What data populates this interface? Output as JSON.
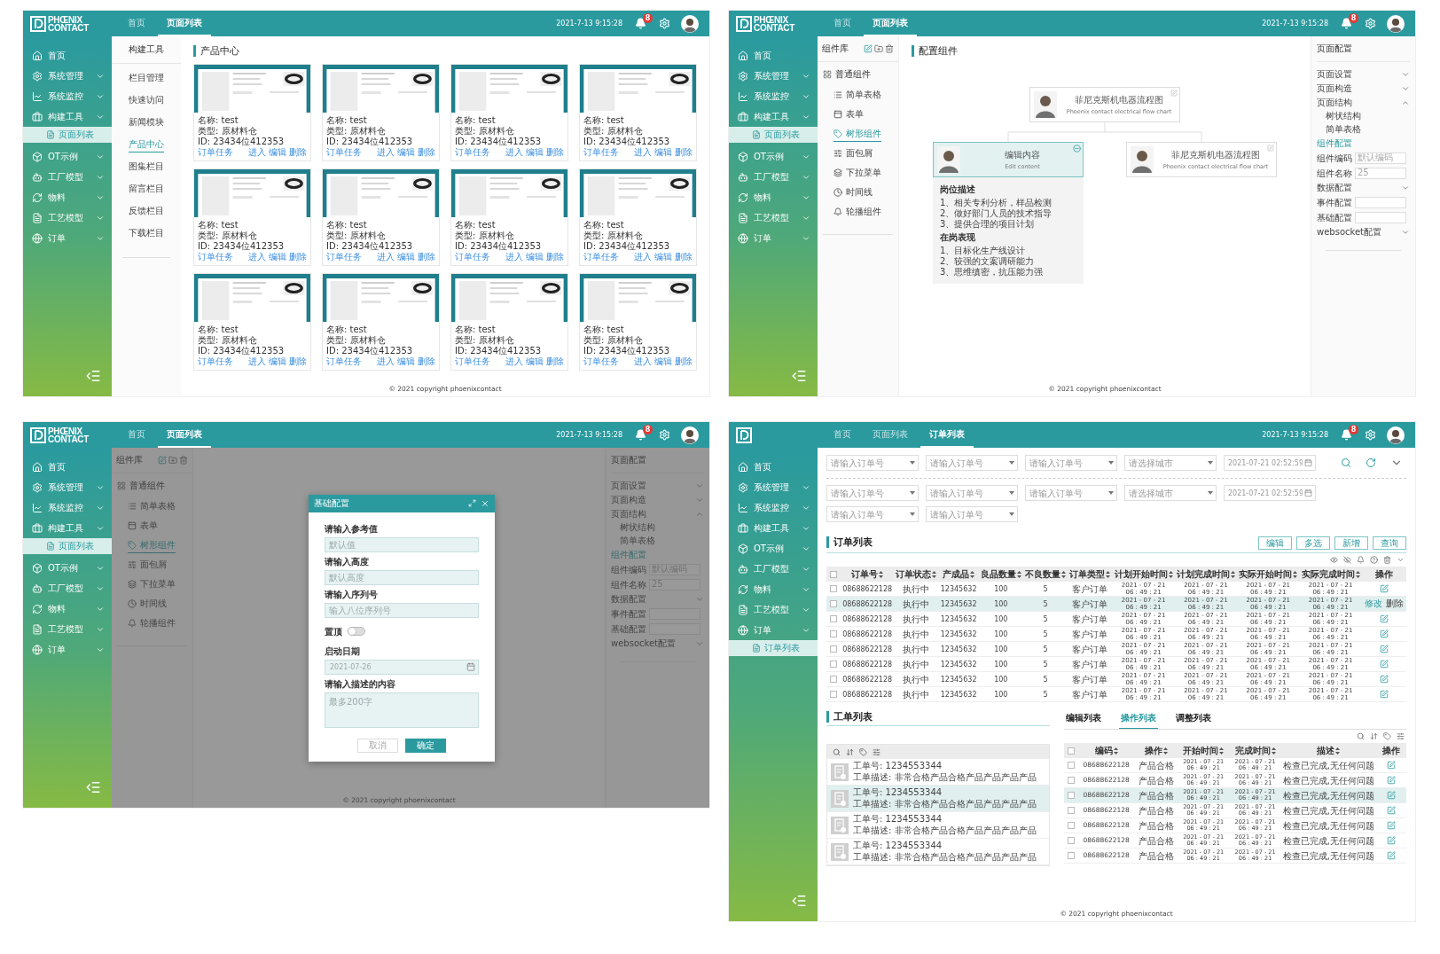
{
  "screens": [
    {
      "kind": "product_grid",
      "header": {
        "logo": {
          "line1": "PHŒNIX",
          "line2": "CONTACT"
        },
        "nav": [
          {
            "label": "首页",
            "selected": false
          },
          {
            "label": "页面列表",
            "selected": true
          }
        ],
        "datetime": "2021-7-13 9:15:28",
        "badge": "8"
      },
      "sidebar": {
        "items": [
          {
            "label": "首页",
            "submenu": false
          },
          {
            "label": "系统管理",
            "submenu": true
          },
          {
            "label": "系统监控",
            "submenu": true
          },
          {
            "label": "构建工具",
            "submenu": true,
            "children": [
              {
                "label": "页面列表",
                "selected": true
              }
            ]
          },
          {
            "label": "OT示例",
            "submenu": true
          },
          {
            "label": "工厂模型",
            "submenu": true
          },
          {
            "label": "物料",
            "submenu": true
          },
          {
            "label": "工艺模型",
            "submenu": true
          },
          {
            "label": "订单",
            "submenu": true
          }
        ]
      },
      "subnav": {
        "title": "构建工具",
        "items": [
          {
            "label": "栏目管理",
            "selected": false
          },
          {
            "label": "快速访问",
            "selected": false
          },
          {
            "label": "新闻模块",
            "selected": false
          },
          {
            "label": "产品中心",
            "selected": true
          },
          {
            "label": "图集栏目",
            "selected": false
          },
          {
            "label": "留言栏目",
            "selected": false
          },
          {
            "label": "反馈栏目",
            "selected": false
          },
          {
            "label": "下载栏目",
            "selected": false
          }
        ]
      },
      "main": {
        "title": "产品中心",
        "products": [
          {
            "name": "名称: test",
            "type": "类型: 原材料仓",
            "id": "ID: 23434位412353",
            "link": "订单任务",
            "actions": [
              "进入",
              "编辑",
              "删除"
            ]
          },
          {
            "name": "名称: test",
            "type": "类型: 原材料仓",
            "id": "ID: 23434位412353",
            "link": "订单任务",
            "actions": [
              "进入",
              "编辑",
              "删除"
            ]
          },
          {
            "name": "名称: test",
            "type": "类型: 原材料仓",
            "id": "ID: 23434位412353",
            "link": "订单任务",
            "actions": [
              "进入",
              "编辑",
              "删除"
            ]
          },
          {
            "name": "名称: test",
            "type": "类型: 原材料仓",
            "id": "ID: 23434位412353",
            "link": "订单任务",
            "actions": [
              "进入",
              "编辑",
              "删除"
            ]
          },
          {
            "name": "名称: test",
            "type": "类型: 原材料仓",
            "id": "ID: 23434位412353",
            "link": "订单任务",
            "actions": [
              "进入",
              "编辑",
              "删除"
            ]
          },
          {
            "name": "名称: test",
            "type": "类型: 原材料仓",
            "id": "ID: 23434位412353",
            "link": "订单任务",
            "actions": [
              "进入",
              "编辑",
              "删除"
            ]
          },
          {
            "name": "名称: test",
            "type": "类型: 原材料仓",
            "id": "ID: 23434位412353",
            "link": "订单任务",
            "actions": [
              "进入",
              "编辑",
              "删除"
            ]
          },
          {
            "name": "名称: test",
            "type": "类型: 原材料仓",
            "id": "ID: 23434位412353",
            "link": "订单任务",
            "actions": [
              "进入",
              "编辑",
              "删除"
            ]
          },
          {
            "name": "名称: test",
            "type": "类型: 原材料仓",
            "id": "ID: 23434位412353",
            "link": "订单任务",
            "actions": [
              "进入",
              "编辑",
              "删除"
            ]
          },
          {
            "name": "名称: test",
            "type": "类型: 原材料仓",
            "id": "ID: 23434位412353",
            "link": "订单任务",
            "actions": [
              "进入",
              "编辑",
              "删除"
            ]
          },
          {
            "name": "名称: test",
            "type": "类型: 原材料仓",
            "id": "ID: 23434位412353",
            "link": "订单任务",
            "actions": [
              "进入",
              "编辑",
              "删除"
            ]
          },
          {
            "name": "名称: test",
            "type": "类型: 原材料仓",
            "id": "ID: 23434位412353",
            "link": "订单任务",
            "actions": [
              "进入",
              "编辑",
              "删除"
            ]
          }
        ]
      },
      "footer": "© 2021 copyright phoenixcontact"
    },
    {
      "kind": "component_config",
      "header": {
        "logo": {
          "line1": "PHŒNIX",
          "line2": "CONTACT"
        },
        "nav": [
          {
            "label": "首页",
            "selected": false
          },
          {
            "label": "页面列表",
            "selected": true
          }
        ],
        "datetime": "2021-7-13 9:15:28",
        "badge": "8"
      },
      "sidebar": {
        "items": [
          {
            "label": "首页",
            "submenu": false
          },
          {
            "label": "系统管理",
            "submenu": true
          },
          {
            "label": "系统监控",
            "submenu": true
          },
          {
            "label": "构建工具",
            "submenu": true,
            "children": [
              {
                "label": "页面列表",
                "selected": true
              }
            ]
          },
          {
            "label": "OT示例",
            "submenu": true
          },
          {
            "label": "工厂模型",
            "submenu": true
          },
          {
            "label": "物料",
            "submenu": true
          },
          {
            "label": "工艺模型",
            "submenu": true
          },
          {
            "label": "订单",
            "submenu": true
          }
        ]
      },
      "library": {
        "title": "组件库",
        "group": "普通组件",
        "items": [
          {
            "label": "简单表格",
            "selected": false
          },
          {
            "label": "表单",
            "selected": false
          },
          {
            "label": "树形组件",
            "selected": true
          },
          {
            "label": "面包屑",
            "selected": false
          },
          {
            "label": "下拉菜单",
            "selected": false
          },
          {
            "label": "时间线",
            "selected": false
          },
          {
            "label": "轮播组件",
            "selected": false
          }
        ]
      },
      "main": {
        "title": "配置组件",
        "tree": {
          "root": {
            "title": "菲尼克斯机电器流程图",
            "subtitle": "Phoenix contact electrical flow chart",
            "selected": false
          },
          "children": [
            {
              "title": "编辑内容",
              "subtitle": "Edit content",
              "selected": true,
              "details": [
                {
                  "heading": "岗位描述",
                  "lines": [
                    "1、相关专利分析，样品检测",
                    "2、做好部门人员的技术指导",
                    "3、提供合理的项目计划"
                  ]
                },
                {
                  "heading": "在岗表现",
                  "lines": [
                    "1、目标化生产线设计",
                    "2、较强的文案调研能力",
                    "3、思维缜密，抗压能力强"
                  ]
                }
              ]
            },
            {
              "title": "菲尼克斯机电器流程图",
              "subtitle": "Phoenix contact electrical flow chart",
              "selected": false
            }
          ]
        }
      },
      "config_panel": {
        "title": "页面配置",
        "rows": [
          {
            "kind": "section",
            "label": "页面设置",
            "expanded": false
          },
          {
            "kind": "section",
            "label": "页面构造",
            "expanded": false
          },
          {
            "kind": "section",
            "label": "页面结构",
            "expanded": true,
            "children": [
              {
                "label": "树状结构"
              },
              {
                "label": "简单表格"
              }
            ]
          },
          {
            "kind": "heading",
            "label": "组件配置"
          },
          {
            "kind": "field",
            "label": "组件编码",
            "placeholder": "默认编码"
          },
          {
            "kind": "field",
            "label": "组件名称",
            "placeholder": "25"
          },
          {
            "kind": "section",
            "label": "数据配置",
            "expanded": false
          },
          {
            "kind": "field",
            "label": "事件配置"
          },
          {
            "kind": "field",
            "label": "基础配置"
          },
          {
            "kind": "section",
            "label": "websocket配置",
            "expanded": false
          }
        ]
      },
      "footer": "© 2021 copyright phoenixcontact"
    },
    {
      "kind": "component_dialog",
      "header": {
        "logo": {
          "line1": "PHŒNIX",
          "line2": "CONTACT"
        },
        "nav": [
          {
            "label": "首页",
            "selected": false
          },
          {
            "label": "页面列表",
            "selected": true
          }
        ],
        "datetime": "2021-7-13 9:15:28",
        "badge": "8"
      },
      "sidebar": {
        "items": [
          {
            "label": "首页",
            "submenu": false
          },
          {
            "label": "系统管理",
            "submenu": true
          },
          {
            "label": "系统监控",
            "submenu": true
          },
          {
            "label": "构建工具",
            "submenu": true,
            "children": [
              {
                "label": "页面列表",
                "selected": true
              }
            ]
          },
          {
            "label": "OT示例",
            "submenu": true
          },
          {
            "label": "工厂模型",
            "submenu": true
          },
          {
            "label": "物料",
            "submenu": true
          },
          {
            "label": "工艺模型",
            "submenu": true
          },
          {
            "label": "订单",
            "submenu": true
          }
        ]
      },
      "library": {
        "title": "组件库",
        "group": "普通组件",
        "items": [
          {
            "label": "简单表格",
            "selected": false
          },
          {
            "label": "表单",
            "selected": false
          },
          {
            "label": "树形组件",
            "selected": true
          },
          {
            "label": "面包屑",
            "selected": false
          },
          {
            "label": "下拉菜单",
            "selected": false
          },
          {
            "label": "时间线",
            "selected": false
          },
          {
            "label": "轮播组件",
            "selected": false
          }
        ]
      },
      "config_panel": {
        "title": "页面配置",
        "rows": [
          {
            "kind": "section",
            "label": "页面设置",
            "expanded": false
          },
          {
            "kind": "section",
            "label": "页面构造",
            "expanded": false
          },
          {
            "kind": "section",
            "label": "页面结构",
            "expanded": true,
            "children": [
              {
                "label": "树状结构"
              },
              {
                "label": "简单表格"
              }
            ]
          },
          {
            "kind": "heading",
            "label": "组件配置"
          },
          {
            "kind": "field",
            "label": "组件编码",
            "placeholder": "默认编码"
          },
          {
            "kind": "field",
            "label": "组件名称",
            "placeholder": "25"
          },
          {
            "kind": "section",
            "label": "数据配置",
            "expanded": false
          },
          {
            "kind": "field",
            "label": "事件配置"
          },
          {
            "kind": "field",
            "label": "基础配置"
          },
          {
            "kind": "section",
            "label": "websocket配置",
            "expanded": false
          }
        ]
      },
      "dialog": {
        "title": "基础配置",
        "fields": [
          {
            "kind": "input",
            "label": "请输入参考值",
            "placeholder": "默认值"
          },
          {
            "kind": "input",
            "label": "请输入高度",
            "placeholder": "默认高度"
          },
          {
            "kind": "input",
            "label": "请输入序列号",
            "placeholder": "输入八位序列号"
          },
          {
            "kind": "toggle",
            "label": "置顶",
            "on": false
          },
          {
            "kind": "date",
            "label": "启动日期",
            "placeholder": "2021-07-26"
          },
          {
            "kind": "textarea",
            "label": "请输入描述的内容",
            "placeholder": "最多200字"
          }
        ],
        "buttons": [
          {
            "label": "取消",
            "primary": false
          },
          {
            "label": "确定",
            "primary": true
          }
        ]
      },
      "footer": "© 2021 copyright phoenixcontact"
    },
    {
      "kind": "order_list",
      "header": {
        "nav": [
          {
            "label": "首页",
            "selected": false
          },
          {
            "label": "页面列表",
            "selected": false
          },
          {
            "label": "订单列表",
            "selected": true
          }
        ],
        "datetime": "2021-7-13 9:15:28",
        "badge": "8"
      },
      "sidebar": {
        "items": [
          {
            "label": "首页",
            "submenu": false
          },
          {
            "label": "系统管理",
            "submenu": true
          },
          {
            "label": "系统监控",
            "submenu": true
          },
          {
            "label": "构建工具",
            "submenu": true
          },
          {
            "label": "OT示例",
            "submenu": true
          },
          {
            "label": "工厂模型",
            "submenu": true
          },
          {
            "label": "物料",
            "submenu": true
          },
          {
            "label": "工艺模型",
            "submenu": true
          },
          {
            "label": "订单",
            "submenu": true,
            "children": [
              {
                "label": "订单列表",
                "selected": true
              }
            ]
          }
        ]
      },
      "filters": [
        [
          {
            "kind": "select",
            "placeholder": "请输入订单号"
          },
          {
            "kind": "select",
            "placeholder": "请输入订单号"
          },
          {
            "kind": "select",
            "placeholder": "请输入订单号"
          },
          {
            "kind": "select",
            "placeholder": "请选择城市"
          },
          {
            "kind": "date",
            "placeholder": "2021-07-21 02:52:59"
          }
        ],
        [
          {
            "kind": "select",
            "placeholder": "请输入订单号"
          },
          {
            "kind": "select",
            "placeholder": "请输入订单号"
          },
          {
            "kind": "select",
            "placeholder": "请输入订单号"
          },
          {
            "kind": "select",
            "placeholder": "请选择城市"
          },
          {
            "kind": "date",
            "placeholder": "2021-07-21 02:52:59"
          }
        ],
        [
          {
            "kind": "select",
            "placeholder": "请输入订单号"
          },
          {
            "kind": "select",
            "placeholder": "请输入订单号"
          }
        ]
      ],
      "orders": {
        "title": "订单列表",
        "buttons": [
          "编辑",
          "多选",
          "新增",
          "查询"
        ],
        "columns": [
          "订单号",
          "订单状态",
          "产成品",
          "良品数量",
          "不良数量",
          "订单类型",
          "计划开始时间",
          "计划完成时间",
          "实际开始时间",
          "实际完成时间",
          "操作"
        ],
        "header_checked": false,
        "rows": [
          {
            "checked": false,
            "selected": false,
            "cells": [
              "08688622128",
              "执行中",
              "12345632",
              "100",
              "5",
              "客户订单",
              "2021 - 07 - 21\n06 : 49 : 21",
              "2021 - 07 - 21\n06 : 49 : 21",
              "2021 - 07 - 21\n06 : 49 : 21",
              "2021 - 07 - 21\n06 : 49 : 21"
            ]
          },
          {
            "checked": false,
            "selected": true,
            "cells": [
              "08688622128",
              "执行中",
              "12345632",
              "100",
              "5",
              "客户订单",
              "2021 - 07 - 21\n06 : 49 : 21",
              "2021 - 07 - 21\n06 : 49 : 21",
              "2021 - 07 - 21\n06 : 49 : 21",
              "2021 - 07 - 21\n06 : 49 : 21"
            ],
            "actions": [
              "修改",
              "删除"
            ]
          },
          {
            "checked": false,
            "selected": false,
            "cells": [
              "08688622128",
              "执行中",
              "12345632",
              "100",
              "5",
              "客户订单",
              "2021 - 07 - 21\n06 : 49 : 21",
              "2021 - 07 - 21\n06 : 49 : 21",
              "2021 - 07 - 21\n06 : 49 : 21",
              "2021 - 07 - 21\n06 : 49 : 21"
            ]
          },
          {
            "checked": false,
            "selected": false,
            "cells": [
              "08688622128",
              "执行中",
              "12345632",
              "100",
              "5",
              "客户订单",
              "2021 - 07 - 21\n06 : 49 : 21",
              "2021 - 07 - 21\n06 : 49 : 21",
              "2021 - 07 - 21\n06 : 49 : 21",
              "2021 - 07 - 21\n06 : 49 : 21"
            ]
          },
          {
            "checked": false,
            "selected": false,
            "cells": [
              "08688622128",
              "执行中",
              "12345632",
              "100",
              "5",
              "客户订单",
              "2021 - 07 - 21\n06 : 49 : 21",
              "2021 - 07 - 21\n06 : 49 : 21",
              "2021 - 07 - 21\n06 : 49 : 21",
              "2021 - 07 - 21\n06 : 49 : 21"
            ]
          },
          {
            "checked": false,
            "selected": false,
            "cells": [
              "08688622128",
              "执行中",
              "12345632",
              "100",
              "5",
              "客户订单",
              "2021 - 07 - 21\n06 : 49 : 21",
              "2021 - 07 - 21\n06 : 49 : 21",
              "2021 - 07 - 21\n06 : 49 : 21",
              "2021 - 07 - 21\n06 : 49 : 21"
            ]
          },
          {
            "checked": false,
            "selected": false,
            "cells": [
              "08688622128",
              "执行中",
              "12345632",
              "100",
              "5",
              "客户订单",
              "2021 - 07 - 21\n06 : 49 : 21",
              "2021 - 07 - 21\n06 : 49 : 21",
              "2021 - 07 - 21\n06 : 49 : 21",
              "2021 - 07 - 21\n06 : 49 : 21"
            ]
          },
          {
            "checked": false,
            "selected": false,
            "cells": [
              "08688622128",
              "执行中",
              "12345632",
              "100",
              "5",
              "客户订单",
              "2021 - 07 - 21\n06 : 49 : 21",
              "2021 - 07 - 21\n06 : 49 : 21",
              "2021 - 07 - 21\n06 : 49 : 21",
              "2021 - 07 - 21\n06 : 49 : 21"
            ]
          }
        ]
      },
      "work_orders": {
        "title": "工单列表",
        "items": [
          {
            "number": "工单号: 1234553344",
            "description": "工单描述: 非常合格产品合格产品产品产品产品",
            "selected": false
          },
          {
            "number": "工单号: 1234553344",
            "description": "工单描述: 非常合格产品合格产品产品产品产品",
            "selected": true
          },
          {
            "number": "工单号: 1234553344",
            "description": "工单描述: 非常合格产品合格产品产品产品产品",
            "selected": false
          },
          {
            "number": "工单号: 1234553344",
            "description": "工单描述: 非常合格产品合格产品产品产品产品",
            "selected": false
          }
        ]
      },
      "operations": {
        "tabs": [
          {
            "label": "编辑列表",
            "selected": false
          },
          {
            "label": "操作列表",
            "selected": true
          },
          {
            "label": "调整列表",
            "selected": false
          }
        ],
        "columns": [
          "编码",
          "操作",
          "开始时间",
          "完成时间",
          "描述",
          "操作"
        ],
        "header_checked": false,
        "rows": [
          {
            "checked": false,
            "selected": false,
            "cells": [
              "08688622128",
              "产品合格",
              "2021 - 07 - 21\n06 : 49 : 21",
              "2021 - 07 - 21\n06 : 49 : 21",
              "检查已完成,无任何问题"
            ]
          },
          {
            "checked": false,
            "selected": false,
            "cells": [
              "08688622128",
              "产品合格",
              "2021 - 07 - 21\n06 : 49 : 21",
              "2021 - 07 - 21\n06 : 49 : 21",
              "检查已完成,无任何问题"
            ]
          },
          {
            "checked": false,
            "selected": true,
            "cells": [
              "08688622128",
              "产品合格",
              "2021 - 07 - 21\n06 : 49 : 21",
              "2021 - 07 - 21\n06 : 49 : 21",
              "检查已完成,无任何问题"
            ]
          },
          {
            "checked": false,
            "selected": false,
            "cells": [
              "08688622128",
              "产品合格",
              "2021 - 07 - 21\n06 : 49 : 21",
              "2021 - 07 - 21\n06 : 49 : 21",
              "检查已完成,无任何问题"
            ]
          },
          {
            "checked": false,
            "selected": false,
            "cells": [
              "08688622128",
              "产品合格",
              "2021 - 07 - 21\n06 : 49 : 21",
              "2021 - 07 - 21\n06 : 49 : 21",
              "检查已完成,无任何问题"
            ]
          },
          {
            "checked": false,
            "selected": false,
            "cells": [
              "08688622128",
              "产品合格",
              "2021 - 07 - 21\n06 : 49 : 21",
              "2021 - 07 - 21\n06 : 49 : 21",
              "检查已完成,无任何问题"
            ]
          },
          {
            "checked": false,
            "selected": false,
            "cells": [
              "08688622128",
              "产品合格",
              "2021 - 07 - 21\n06 : 49 : 21",
              "2021 - 07 - 21\n06 : 49 : 21",
              "检查已完成,无任何问题"
            ]
          }
        ]
      },
      "footer": "© 2021 copyright phoenixcontact"
    }
  ]
}
